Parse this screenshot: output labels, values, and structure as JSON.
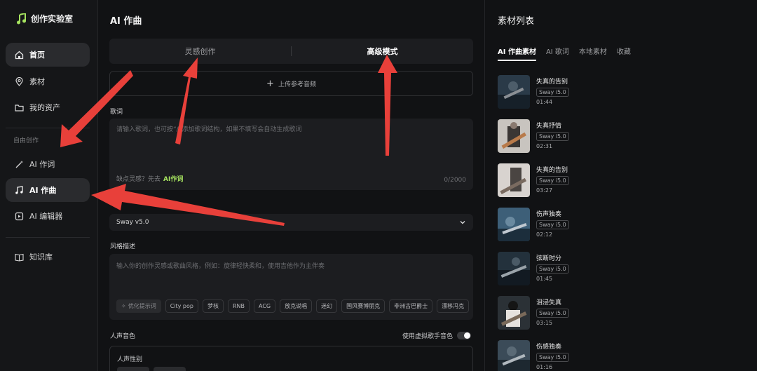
{
  "brand": {
    "name": "创作实验室",
    "accent": "#a6e35f"
  },
  "sidebar": {
    "items": [
      {
        "label": "首页",
        "icon": "home-icon",
        "active": true
      },
      {
        "label": "素材",
        "icon": "pin-icon"
      },
      {
        "label": "我的资产",
        "icon": "folder-icon"
      }
    ],
    "section_label": "自由创作",
    "free_items": [
      {
        "label": "AI 作词",
        "icon": "magic-wand-icon"
      },
      {
        "label": "AI 作曲",
        "icon": "music-note-icon",
        "active": true
      },
      {
        "label": "AI 编辑器",
        "icon": "editor-icon"
      }
    ],
    "bottom_items": [
      {
        "label": "知识库",
        "icon": "book-icon"
      }
    ]
  },
  "main": {
    "title": "AI 作曲",
    "tabs": [
      {
        "label": "灵感创作"
      },
      {
        "label": "高级模式",
        "active": true
      }
    ],
    "upload_label": "上传参考音频",
    "lyrics": {
      "label": "歌词",
      "placeholder": "请输入歌词，也可按“/”添加歌词结构，如果不填写会自动生成歌词",
      "hint": "缺点灵感？先去",
      "hint_link": "AI作词",
      "counter": "0/2000"
    },
    "model_select": {
      "value": "Sway v5.0"
    },
    "style": {
      "label": "风格描述",
      "placeholder": "输入你的创作灵感或歌曲风格，例如：旋律轻快柔和，使用吉他作为主伴奏",
      "optimize_label": "优化提示词",
      "chips": [
        "City pop",
        "梦核",
        "RNB",
        "ACG",
        "放克说唱",
        "迷幻",
        "国风赛博朋克",
        "非洲古巴爵士",
        "漂移冯克"
      ]
    },
    "voice": {
      "label": "人声音色",
      "toggle_label": "使用虚拟歌手音色",
      "gender_label": "人声性别"
    }
  },
  "right_panel": {
    "title": "素材列表",
    "tabs": [
      {
        "label": "AI 作曲素材",
        "active": true
      },
      {
        "label": "AI 歌词"
      },
      {
        "label": "本地素材"
      },
      {
        "label": "收藏"
      }
    ],
    "items": [
      {
        "title": "失真的告别",
        "badge": "Sway i5.0",
        "duration": "01:44"
      },
      {
        "title": "失真抒情",
        "badge": "Sway i5.0",
        "duration": "02:31"
      },
      {
        "title": "失真的告别",
        "badge": "Sway i5.0",
        "duration": "03:27"
      },
      {
        "title": "伤声独奏",
        "badge": "Sway i5.0",
        "duration": "02:12"
      },
      {
        "title": "弦断时分",
        "badge": "Sway i5.0",
        "duration": "01:45"
      },
      {
        "title": "泪浸失真",
        "badge": "Sway i5.0",
        "duration": "03:15"
      },
      {
        "title": "伤感独奏",
        "badge": "Sway i5.0",
        "duration": "01:16"
      }
    ]
  },
  "annotation_color": "#e8403a"
}
